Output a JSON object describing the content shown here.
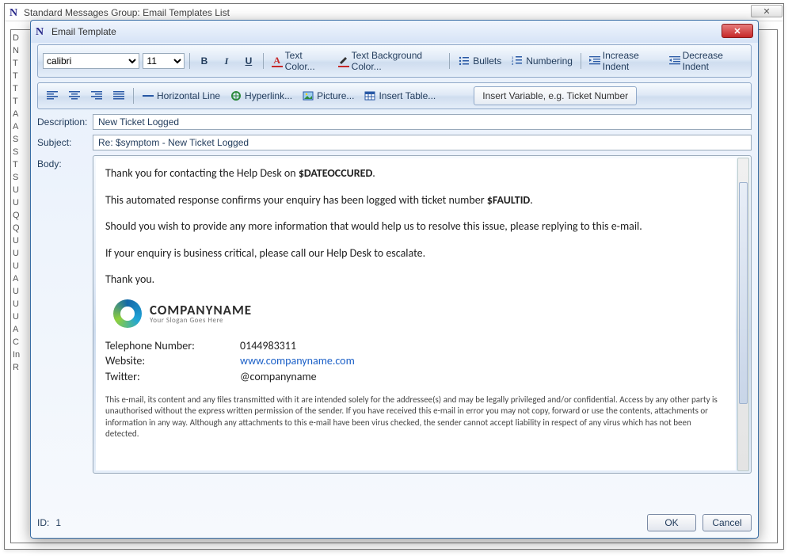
{
  "parent": {
    "title": "Standard Messages Group: Email Templates List",
    "close_glyph": "✕",
    "list_initials": [
      "D",
      "N",
      "T",
      "T",
      "T",
      "T",
      "A",
      "A",
      "S",
      "S",
      "T",
      "S",
      "U",
      "U",
      "Q",
      "Q",
      "U",
      "U",
      "U",
      "A",
      "U",
      "U",
      "U",
      "A",
      "C",
      "In",
      "R"
    ]
  },
  "modal": {
    "title": "Email Template",
    "close_glyph": "✕"
  },
  "toolbar1": {
    "font": "calibri",
    "size": "11",
    "bold": "B",
    "italic": "I",
    "underline": "U",
    "text_color": "Text Color...",
    "bg_color": "Text Background Color...",
    "bullets": "Bullets",
    "numbering": "Numbering",
    "inc_indent": "Increase Indent",
    "dec_indent": "Decrease Indent"
  },
  "toolbar2": {
    "hr": "Horizontal Line",
    "hyperlink": "Hyperlink...",
    "picture": "Picture...",
    "table": "Insert Table...",
    "insert_var": "Insert Variable, e.g. Ticket Number"
  },
  "form": {
    "desc_label": "Description:",
    "desc_value": "New Ticket Logged",
    "subj_label": "Subject:",
    "subj_value": "Re: $symptom - New Ticket Logged",
    "body_label": "Body:"
  },
  "body": {
    "p1a": "Thank you for contacting the Help Desk on ",
    "p1b": "$DATEOCCURED",
    "p1c": ".",
    "p2a": "This automated response confirms your enquiry has been logged with ticket number ",
    "p2b": "$FAULTID",
    "p2c": ".",
    "p3": "Should you wish to provide any more information that would help us to resolve this issue, please replying to this e-mail.",
    "p4": "If your enquiry is business critical, please call our Help Desk to escalate.",
    "p5": "Thank you.",
    "company_name": "COMPANYNAME",
    "company_slogan": "Your Slogan Goes Here",
    "tel_label": "Telephone Number:",
    "tel_value": "0144983311",
    "web_label": "Website:",
    "web_value": "www.companyname.com",
    "tw_label": "Twitter:",
    "tw_value": " @companyname",
    "fineprint": "This e-mail, its content and any files transmitted with it are intended solely for the addressee(s) and may be legally privileged and/or confidential. Access by any other party is unauthorised without the express written permission of the sender. If you have received this e-mail in error you may not copy, forward or use the contents, attachments or information in any way. Although any attachments to this e-mail have been virus checked, the sender cannot accept liability in respect of any virus which has not been detected."
  },
  "bottom": {
    "id_label": "ID:",
    "id_value": "1",
    "ok": "OK",
    "cancel": "Cancel"
  }
}
